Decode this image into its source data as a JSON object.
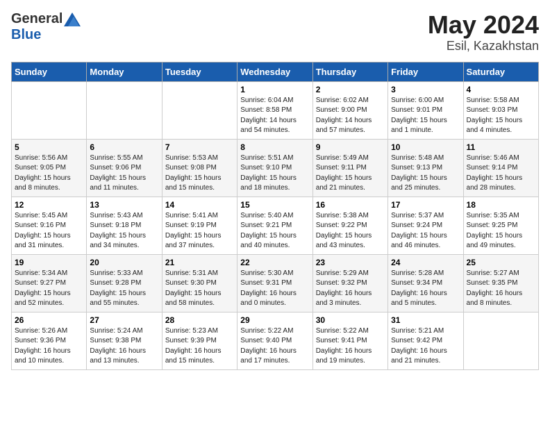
{
  "header": {
    "logo_general": "General",
    "logo_blue": "Blue",
    "month": "May 2024",
    "location": "Esil, Kazakhstan"
  },
  "days_of_week": [
    "Sunday",
    "Monday",
    "Tuesday",
    "Wednesday",
    "Thursday",
    "Friday",
    "Saturday"
  ],
  "weeks": [
    [
      {
        "day": "",
        "sunrise": "",
        "sunset": "",
        "daylight": ""
      },
      {
        "day": "",
        "sunrise": "",
        "sunset": "",
        "daylight": ""
      },
      {
        "day": "",
        "sunrise": "",
        "sunset": "",
        "daylight": ""
      },
      {
        "day": "1",
        "sunrise": "Sunrise: 6:04 AM",
        "sunset": "Sunset: 8:58 PM",
        "daylight": "Daylight: 14 hours and 54 minutes."
      },
      {
        "day": "2",
        "sunrise": "Sunrise: 6:02 AM",
        "sunset": "Sunset: 9:00 PM",
        "daylight": "Daylight: 14 hours and 57 minutes."
      },
      {
        "day": "3",
        "sunrise": "Sunrise: 6:00 AM",
        "sunset": "Sunset: 9:01 PM",
        "daylight": "Daylight: 15 hours and 1 minute."
      },
      {
        "day": "4",
        "sunrise": "Sunrise: 5:58 AM",
        "sunset": "Sunset: 9:03 PM",
        "daylight": "Daylight: 15 hours and 4 minutes."
      }
    ],
    [
      {
        "day": "5",
        "sunrise": "Sunrise: 5:56 AM",
        "sunset": "Sunset: 9:05 PM",
        "daylight": "Daylight: 15 hours and 8 minutes."
      },
      {
        "day": "6",
        "sunrise": "Sunrise: 5:55 AM",
        "sunset": "Sunset: 9:06 PM",
        "daylight": "Daylight: 15 hours and 11 minutes."
      },
      {
        "day": "7",
        "sunrise": "Sunrise: 5:53 AM",
        "sunset": "Sunset: 9:08 PM",
        "daylight": "Daylight: 15 hours and 15 minutes."
      },
      {
        "day": "8",
        "sunrise": "Sunrise: 5:51 AM",
        "sunset": "Sunset: 9:10 PM",
        "daylight": "Daylight: 15 hours and 18 minutes."
      },
      {
        "day": "9",
        "sunrise": "Sunrise: 5:49 AM",
        "sunset": "Sunset: 9:11 PM",
        "daylight": "Daylight: 15 hours and 21 minutes."
      },
      {
        "day": "10",
        "sunrise": "Sunrise: 5:48 AM",
        "sunset": "Sunset: 9:13 PM",
        "daylight": "Daylight: 15 hours and 25 minutes."
      },
      {
        "day": "11",
        "sunrise": "Sunrise: 5:46 AM",
        "sunset": "Sunset: 9:14 PM",
        "daylight": "Daylight: 15 hours and 28 minutes."
      }
    ],
    [
      {
        "day": "12",
        "sunrise": "Sunrise: 5:45 AM",
        "sunset": "Sunset: 9:16 PM",
        "daylight": "Daylight: 15 hours and 31 minutes."
      },
      {
        "day": "13",
        "sunrise": "Sunrise: 5:43 AM",
        "sunset": "Sunset: 9:18 PM",
        "daylight": "Daylight: 15 hours and 34 minutes."
      },
      {
        "day": "14",
        "sunrise": "Sunrise: 5:41 AM",
        "sunset": "Sunset: 9:19 PM",
        "daylight": "Daylight: 15 hours and 37 minutes."
      },
      {
        "day": "15",
        "sunrise": "Sunrise: 5:40 AM",
        "sunset": "Sunset: 9:21 PM",
        "daylight": "Daylight: 15 hours and 40 minutes."
      },
      {
        "day": "16",
        "sunrise": "Sunrise: 5:38 AM",
        "sunset": "Sunset: 9:22 PM",
        "daylight": "Daylight: 15 hours and 43 minutes."
      },
      {
        "day": "17",
        "sunrise": "Sunrise: 5:37 AM",
        "sunset": "Sunset: 9:24 PM",
        "daylight": "Daylight: 15 hours and 46 minutes."
      },
      {
        "day": "18",
        "sunrise": "Sunrise: 5:35 AM",
        "sunset": "Sunset: 9:25 PM",
        "daylight": "Daylight: 15 hours and 49 minutes."
      }
    ],
    [
      {
        "day": "19",
        "sunrise": "Sunrise: 5:34 AM",
        "sunset": "Sunset: 9:27 PM",
        "daylight": "Daylight: 15 hours and 52 minutes."
      },
      {
        "day": "20",
        "sunrise": "Sunrise: 5:33 AM",
        "sunset": "Sunset: 9:28 PM",
        "daylight": "Daylight: 15 hours and 55 minutes."
      },
      {
        "day": "21",
        "sunrise": "Sunrise: 5:31 AM",
        "sunset": "Sunset: 9:30 PM",
        "daylight": "Daylight: 15 hours and 58 minutes."
      },
      {
        "day": "22",
        "sunrise": "Sunrise: 5:30 AM",
        "sunset": "Sunset: 9:31 PM",
        "daylight": "Daylight: 16 hours and 0 minutes."
      },
      {
        "day": "23",
        "sunrise": "Sunrise: 5:29 AM",
        "sunset": "Sunset: 9:32 PM",
        "daylight": "Daylight: 16 hours and 3 minutes."
      },
      {
        "day": "24",
        "sunrise": "Sunrise: 5:28 AM",
        "sunset": "Sunset: 9:34 PM",
        "daylight": "Daylight: 16 hours and 5 minutes."
      },
      {
        "day": "25",
        "sunrise": "Sunrise: 5:27 AM",
        "sunset": "Sunset: 9:35 PM",
        "daylight": "Daylight: 16 hours and 8 minutes."
      }
    ],
    [
      {
        "day": "26",
        "sunrise": "Sunrise: 5:26 AM",
        "sunset": "Sunset: 9:36 PM",
        "daylight": "Daylight: 16 hours and 10 minutes."
      },
      {
        "day": "27",
        "sunrise": "Sunrise: 5:24 AM",
        "sunset": "Sunset: 9:38 PM",
        "daylight": "Daylight: 16 hours and 13 minutes."
      },
      {
        "day": "28",
        "sunrise": "Sunrise: 5:23 AM",
        "sunset": "Sunset: 9:39 PM",
        "daylight": "Daylight: 16 hours and 15 minutes."
      },
      {
        "day": "29",
        "sunrise": "Sunrise: 5:22 AM",
        "sunset": "Sunset: 9:40 PM",
        "daylight": "Daylight: 16 hours and 17 minutes."
      },
      {
        "day": "30",
        "sunrise": "Sunrise: 5:22 AM",
        "sunset": "Sunset: 9:41 PM",
        "daylight": "Daylight: 16 hours and 19 minutes."
      },
      {
        "day": "31",
        "sunrise": "Sunrise: 5:21 AM",
        "sunset": "Sunset: 9:42 PM",
        "daylight": "Daylight: 16 hours and 21 minutes."
      },
      {
        "day": "",
        "sunrise": "",
        "sunset": "",
        "daylight": ""
      }
    ]
  ]
}
